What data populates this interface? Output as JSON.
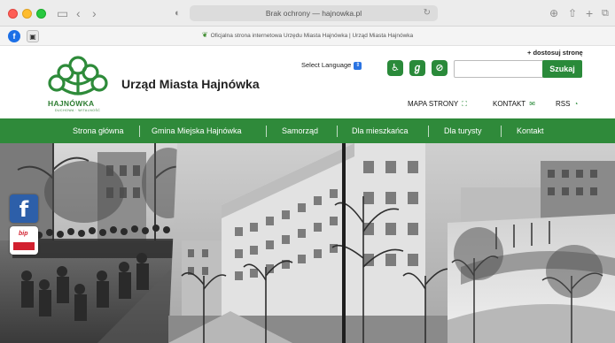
{
  "browser": {
    "address": "Brak ochrony — hajnowka.pl",
    "tab_title": "Oficjalna strona internetowa Urzędu Miasta Hajnówka | Urząd Miasta Hajnówka"
  },
  "header": {
    "logo_word": "HAJNÓWKA",
    "logo_sub": "DUCHOWA · WITALNOŚĆ",
    "title": "Urząd Miasta Hajnówka",
    "language_label": "Select Language",
    "customize_label": "+ dostosuj stronę",
    "search_placeholder": "",
    "search_button": "Szukaj",
    "links": [
      {
        "label": "MAPA STRONY",
        "icon": "sitemap-icon"
      },
      {
        "label": "KONTAKT",
        "icon": "envelope-icon"
      },
      {
        "label": "RSS",
        "icon": "rss-icon"
      }
    ]
  },
  "nav": {
    "items": [
      "Strona główna",
      "Gmina Miejska Hajnówka",
      "Samorząd",
      "Dla mieszkańca",
      "Dla turysty",
      "Kontakt"
    ]
  },
  "side": {
    "fb_label": "f",
    "bip_label": "bip"
  },
  "colors": {
    "brand_green": "#2f8a3a",
    "facebook_blue": "#2d5fa9",
    "bip_red": "#d2202f"
  }
}
